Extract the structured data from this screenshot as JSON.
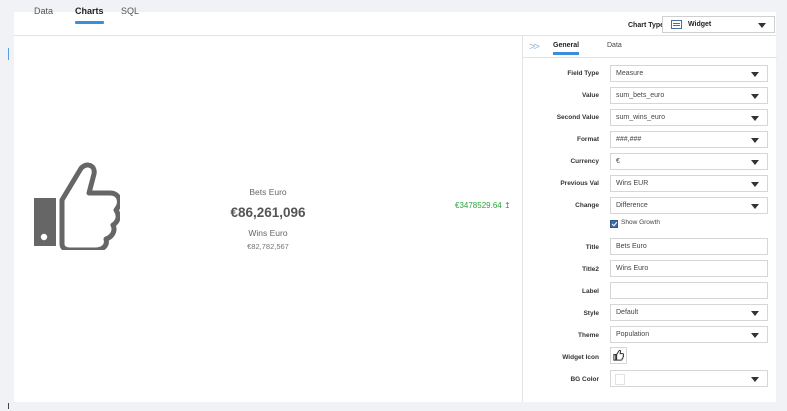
{
  "tabs": [
    {
      "label": "Data",
      "active": false
    },
    {
      "label": "Charts",
      "active": true
    },
    {
      "label": "SQL",
      "active": false
    }
  ],
  "chart_type": {
    "label": "Chart Type:",
    "value": "Widget",
    "icon": "table-icon"
  },
  "preview": {
    "icon": "thumbs-up-icon",
    "title1": "Bets Euro",
    "value1": "€86,261,096",
    "title2": "Wins Euro",
    "value2": "€82,782,567",
    "growth": "€3478529.64 ↥",
    "growth_color": "#2aa63a"
  },
  "panel": {
    "tabs": [
      {
        "label": "General",
        "active": true
      },
      {
        "label": "Data",
        "active": false
      }
    ],
    "fields": {
      "field_type": {
        "label": "Field Type",
        "value": "Measure"
      },
      "value": {
        "label": "Value",
        "value": "sum_bets_euro"
      },
      "second_value": {
        "label": "Second Value",
        "value": "sum_wins_euro"
      },
      "format": {
        "label": "Format",
        "value": "###,###"
      },
      "currency": {
        "label": "Currency",
        "value": "€"
      },
      "previous_val": {
        "label": "Previous Val",
        "value": "Wins EUR"
      },
      "change": {
        "label": "Change",
        "value": "Difference"
      },
      "show_growth": {
        "label": "Show Growth",
        "checked": true
      },
      "title": {
        "label": "Title",
        "value": "Bets Euro"
      },
      "title2": {
        "label": "Title2",
        "value": "Wins Euro"
      },
      "label": {
        "label": "Label",
        "value": ""
      },
      "style": {
        "label": "Style",
        "value": "Default"
      },
      "theme": {
        "label": "Theme",
        "value": "Population"
      },
      "widget_icon": {
        "label": "Widget Icon",
        "icon": "thumbs-up-icon"
      },
      "bg_color": {
        "label": "BG Color",
        "value": "#ffffff"
      }
    }
  },
  "colors": {
    "accent": "#3b8fd9",
    "checkbox": "#3d6ea5",
    "icon": "#666666"
  }
}
